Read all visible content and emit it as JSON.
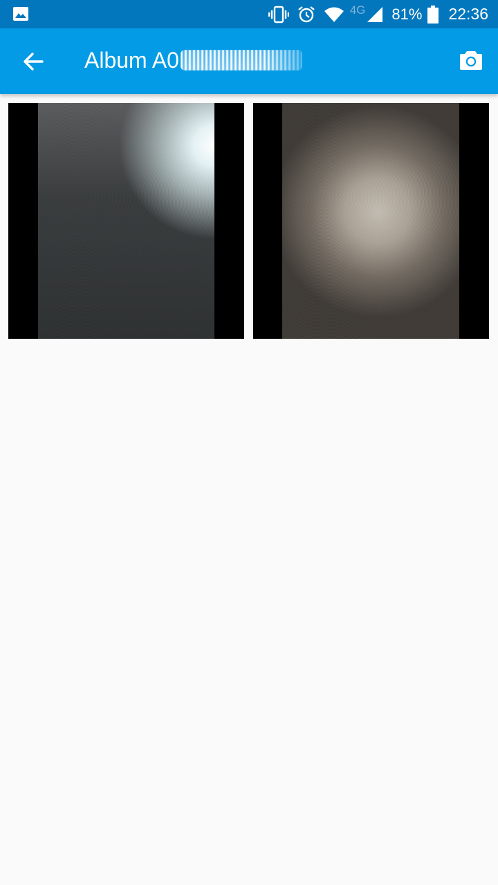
{
  "status_bar": {
    "notification_icon": "image-icon",
    "network_type": "4G",
    "battery_percent": "81%",
    "time": "22:36",
    "icons": [
      "vibrate-icon",
      "alarm-icon",
      "wifi-icon",
      "signal-icon",
      "battery-icon"
    ]
  },
  "app_bar": {
    "title": "Album A0",
    "back_icon": "arrow-back-icon",
    "action_icon": "camera-icon"
  },
  "photos": [
    {
      "name": "photo-1"
    },
    {
      "name": "photo-2"
    }
  ],
  "colors": {
    "status_bar": "#0277bd",
    "app_bar": "#039be5",
    "background": "#fafafa"
  }
}
